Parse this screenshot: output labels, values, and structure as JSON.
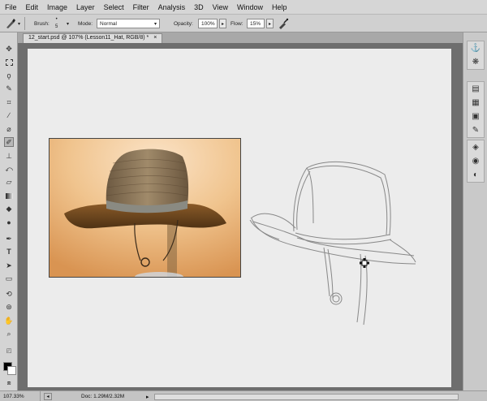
{
  "menu": [
    "File",
    "Edit",
    "Image",
    "Layer",
    "Select",
    "Filter",
    "Analysis",
    "3D",
    "View",
    "Window",
    "Help"
  ],
  "options": {
    "brush_label": "Brush:",
    "brush_size": "5",
    "mode_label": "Mode:",
    "mode_value": "Normal",
    "opacity_label": "Opacity:",
    "opacity_value": "100%",
    "flow_label": "Flow:",
    "flow_value": "15%"
  },
  "document": {
    "tab_title": "12_start.psd @ 107% (Lesson11_Hat, RGB/8) *"
  },
  "status": {
    "zoom": "107.33%",
    "doc_info": "Doc: 1.29M/2.32M"
  },
  "colors": {
    "foreground": "#000000",
    "background": "#ffffff"
  },
  "icons": {
    "toolbox": [
      "move-icon",
      "marquee-icon",
      "lasso-icon",
      "quick-select-icon",
      "crop-icon",
      "eyedropper-icon",
      "healing-icon",
      "brush-icon",
      "clone-stamp-icon",
      "history-brush-icon",
      "eraser-icon",
      "gradient-icon",
      "blur-icon",
      "dodge-icon",
      "pen-icon",
      "type-icon",
      "path-select-icon",
      "shape-icon",
      "3d-rotate-icon",
      "3d-orbit-icon",
      "hand-icon",
      "zoom-icon",
      "quick-mask-icon",
      "screen-mode-icon"
    ],
    "dock": [
      "mini-bridge-icon",
      "kuler-icon",
      "history-icon",
      "swatches-icon",
      "styles-icon",
      "notes-icon",
      "layers-icon",
      "channels-icon",
      "paths-icon"
    ]
  }
}
